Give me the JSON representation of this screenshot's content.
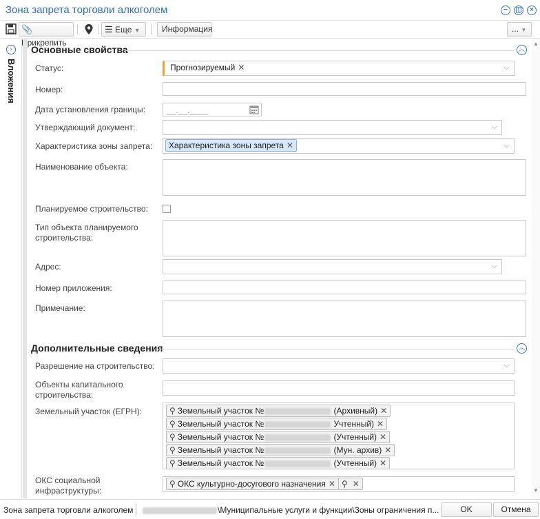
{
  "window": {
    "title": "Зона запрета торговли алкоголем",
    "controls": {
      "minimize": "−",
      "restore": "◫",
      "close": "×"
    }
  },
  "toolbar": {
    "save_icon": "save-icon",
    "attach_label": "Прикрепить",
    "map_icon": "map-pin-icon",
    "more_label": "Еще",
    "info_label": "Информация",
    "overflow_label": "..."
  },
  "sidebar": {
    "label": "Вложения"
  },
  "sections": {
    "main_title": "Основные свойства",
    "extra_title": "Дополнительные сведения"
  },
  "fields": {
    "status_label": "Статус:",
    "status_value": "Прогнозируемый",
    "number_label": "Номер:",
    "border_date_label": "Дата установления границы:",
    "border_date_placeholder": "__.__.____",
    "approving_doc_label": "Утверждающий документ:",
    "zone_char_label": "Характеристика зоны запрета:",
    "zone_char_value": "Характеристика зоны запрета",
    "object_name_label": "Наименование объекта:",
    "planned_construction_label": "Планируемое строительство:",
    "planned_object_type_label": "Тип объекта планируемого строительства:",
    "address_label": "Адрес:",
    "appendix_number_label": "Номер приложения:",
    "note_label": "Примечание:",
    "building_permit_label": "Разрешение на строительство:",
    "capital_objects_label": "Объекты капитального строительства:",
    "land_plot_label": "Земельный участок (ЕГРН):",
    "social_oks_label": "ОКС социальной инфраструктуры:",
    "social_oks_value": "ОКС культурно-досугового назначения"
  },
  "land_plots": [
    {
      "prefix": "Земельный участок №",
      "suffix": " (Архивный)"
    },
    {
      "prefix": "Земельный участок №",
      "suffix": " Учтенный)"
    },
    {
      "prefix": "Земельный участок №",
      "suffix": " (Учтенный)"
    },
    {
      "prefix": "Земельный участок №",
      "suffix": " (Мун. архив)"
    },
    {
      "prefix": "Земельный участок №",
      "suffix": " (Учтенный)"
    }
  ],
  "statusbar": {
    "window_name": "Зона запрета торговли алкоголем",
    "path": "\\Муниципальные услуги и функции\\Зоны ограничения п...",
    "ok_label": "OK",
    "cancel_label": "Отмена"
  },
  "colors": {
    "accent": "#2a6fb7",
    "required_marker": "#f0a030",
    "tag_blue": "#d6e8f7"
  }
}
